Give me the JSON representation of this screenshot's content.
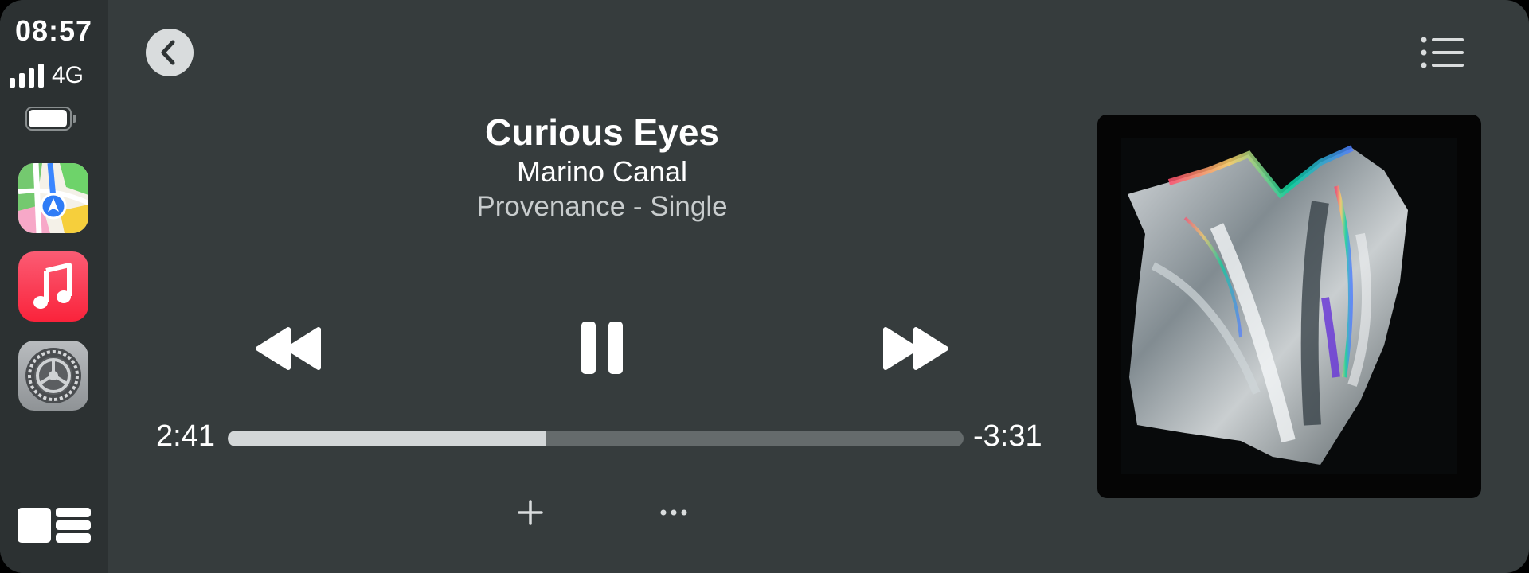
{
  "status": {
    "time": "08:57",
    "network": "4G",
    "signal_bars": 4,
    "battery_level": 1.0
  },
  "sidebar": {
    "apps": [
      {
        "name": "Maps",
        "icon": "maps-icon"
      },
      {
        "name": "Music",
        "icon": "music-icon"
      },
      {
        "name": "Settings",
        "icon": "settings-icon"
      }
    ],
    "dashboard_icon": "dashboard-icon"
  },
  "now_playing": {
    "title": "Curious Eyes",
    "artist": "Marino Canal",
    "album": "Provenance - Single",
    "elapsed": "2:41",
    "remaining": "-3:31",
    "progress": 0.433,
    "is_playing": true
  },
  "icons": {
    "back": "chevron-left-icon",
    "list": "list-icon",
    "rewind": "rewind-icon",
    "pause": "pause-icon",
    "forward": "fast-forward-icon",
    "add": "plus-icon",
    "more": "ellipsis-icon"
  },
  "colors": {
    "background": "#363c3d",
    "sidebar": "#2c3132",
    "progress_fill": "#d3d7d8",
    "progress_track": "#656b6c",
    "music_red": "#fa233b"
  }
}
